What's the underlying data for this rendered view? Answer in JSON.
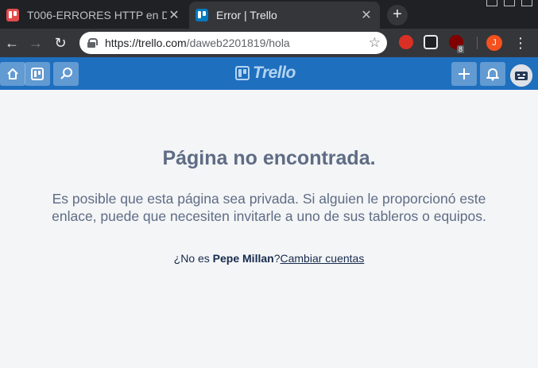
{
  "browser": {
    "tabs": [
      {
        "title": "T006-ERRORES HTTP en D",
        "active": false,
        "close_label": "✕"
      },
      {
        "title": "Error | Trello",
        "active": true,
        "close_label": "✕"
      }
    ],
    "new_tab_label": "+",
    "url_host": "https://trello.com",
    "url_path": "/daweb2201819/hola",
    "profile_initial": "J",
    "extension_badge": "8"
  },
  "header": {
    "logo_text": "Trello",
    "icons": [
      "home-icon",
      "boards-icon",
      "search-icon",
      "plus-icon",
      "bell-icon"
    ]
  },
  "error": {
    "title": "Página no encontrada.",
    "message": "Es posible que esta página sea privada. Si alguien le proporcionó este enlace, puede que necesiten invitarle a uno de sus tableros o equipos.",
    "not_prefix": "¿No es ",
    "user_name": "Pepe Millan",
    "not_suffix": "?",
    "switch_label": "Cambiar cuentas"
  },
  "colors": {
    "header_blue": "#1f6fbf",
    "text_muted": "#5e6c84",
    "page_bg": "#f4f5f7",
    "chrome_dark": "#202124"
  }
}
